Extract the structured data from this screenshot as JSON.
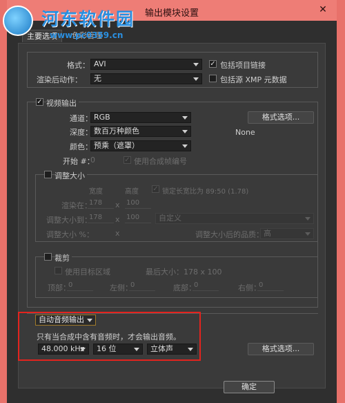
{
  "window": {
    "title": "输出模块设置",
    "close": "✕"
  },
  "watermark": {
    "title": "河东软件园",
    "url": "www.pc0359.cn"
  },
  "tabs": [
    {
      "label": "主要选项"
    },
    {
      "label": "色彩管理"
    }
  ],
  "format": {
    "format_label": "格式：",
    "format_value": "AVI",
    "post_label": "渲染后动作：",
    "post_value": "无",
    "include_project_link": "包括项目链接",
    "include_xmp": "包括源 XMP 元数据"
  },
  "video": {
    "title": "视频输出",
    "channel_label": "通道：",
    "channel_value": "RGB",
    "depth_label": "深度：",
    "depth_value": "数百万种颜色",
    "color_label": "颜色：",
    "color_value": "预乘（遮罩）",
    "start_label": "开始 #：",
    "start_value": "0",
    "use_comp_frame": "使用合成帧编号",
    "format_options": "格式选项...",
    "codec_text": "None"
  },
  "resize": {
    "title": "调整大小",
    "width_header": "宽度",
    "height_header": "高度",
    "lock_ratio": "锁定长宽比为 89:50 (1.78)",
    "render_at_label": "渲染在：",
    "render_w": "178",
    "x1": "x",
    "render_h": "100",
    "resize_to_label": "调整大小到：",
    "resize_w": "178",
    "x2": "x",
    "resize_h": "100",
    "preset_value": "自定义",
    "percent_label": "调整大小 %：",
    "x3": "x",
    "quality_label": "调整大小后的品质：",
    "quality_value": "高"
  },
  "crop": {
    "title": "裁剪",
    "use_roi": "使用目标区域",
    "max_size": "最后大小：178 x 100",
    "top_label": "顶部：",
    "top_value": "0",
    "left_label": "左侧：",
    "left_value": "0",
    "bottom_label": "底部：",
    "bottom_value": "0",
    "right_label": "右侧：",
    "right_value": "0"
  },
  "audio": {
    "mode_value": "自动音频输出",
    "note": "只有当合成中含有音频时，才会输出音频。",
    "rate_value": "48.000 kHz",
    "bits_value": "16 位",
    "channels_value": "立体声",
    "format_options": "格式选项..."
  },
  "footer": {
    "ok": "确定"
  },
  "colors": {
    "highlight": "#e3231e",
    "titlebar": "#ee7d76",
    "panel": "#3a3a3a"
  }
}
